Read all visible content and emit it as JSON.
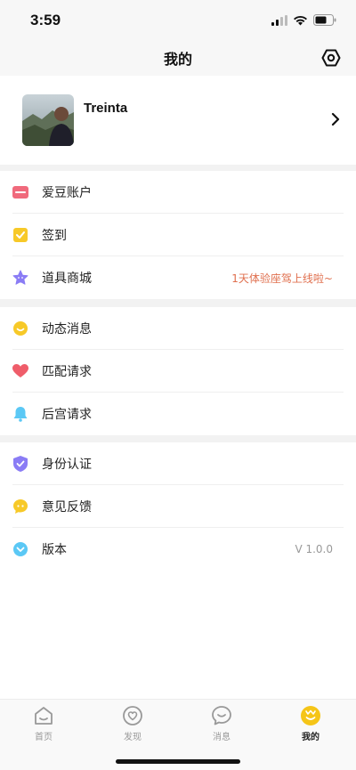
{
  "status": {
    "time": "3:59"
  },
  "header": {
    "title": "我的"
  },
  "profile": {
    "name": "Treinta"
  },
  "group1": [
    {
      "label": "爱豆账户",
      "value": ""
    },
    {
      "label": "签到",
      "value": ""
    },
    {
      "label": "道具商城",
      "value": "1天体验座驾上线啦~"
    }
  ],
  "group2": [
    {
      "label": "动态消息",
      "value": ""
    },
    {
      "label": "匹配请求",
      "value": ""
    },
    {
      "label": "后宫请求",
      "value": ""
    }
  ],
  "group3": [
    {
      "label": "身份认证",
      "value": ""
    },
    {
      "label": "意见反馈",
      "value": ""
    },
    {
      "label": "版本",
      "value": "V 1.0.0"
    }
  ],
  "tabs": [
    {
      "label": "首页"
    },
    {
      "label": "发现"
    },
    {
      "label": "消息"
    },
    {
      "label": "我的"
    }
  ],
  "colors": {
    "accent": "#f5c518",
    "promo": "#e0704f",
    "card_icon": "#f06a7c",
    "check_icon": "#f7c928",
    "star_icon": "#8a7cf5",
    "heart_icon": "#ef5d6a",
    "bell_icon": "#5bc8f5",
    "shield_icon": "#8a7cf5",
    "info_icon": "#5bc8f5"
  }
}
